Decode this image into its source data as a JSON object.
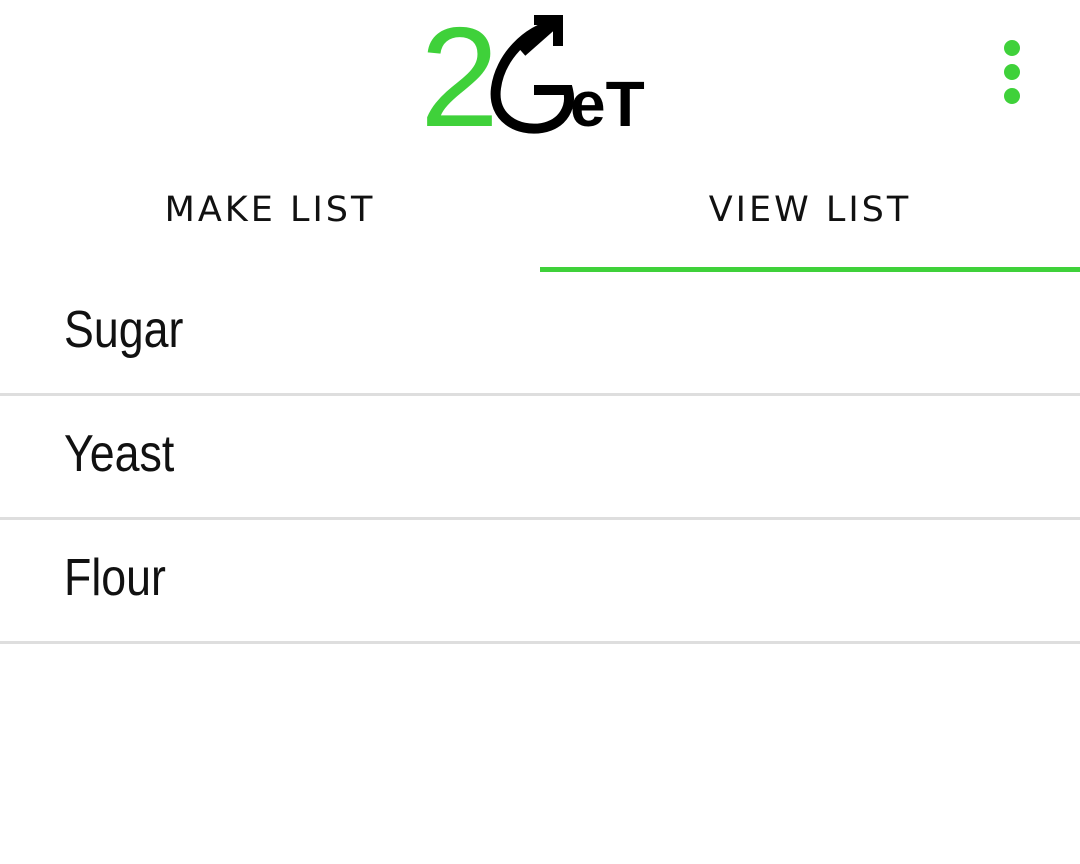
{
  "app": {
    "logo": {
      "digit": "2",
      "wordmark": "GeT",
      "digit_color": "#3fd13a",
      "wordmark_color": "#000000",
      "icon": "arrow-up-right-icon"
    },
    "overflow_menu_icon": "more-vert-icon",
    "accent_color": "#3fd13a"
  },
  "tabs": [
    {
      "label": "MAKE LIST",
      "selected": false
    },
    {
      "label": "VIEW LIST",
      "selected": true
    }
  ],
  "list": {
    "items": [
      {
        "label": "Sugar"
      },
      {
        "label": "Yeast"
      },
      {
        "label": "Flour"
      }
    ]
  }
}
